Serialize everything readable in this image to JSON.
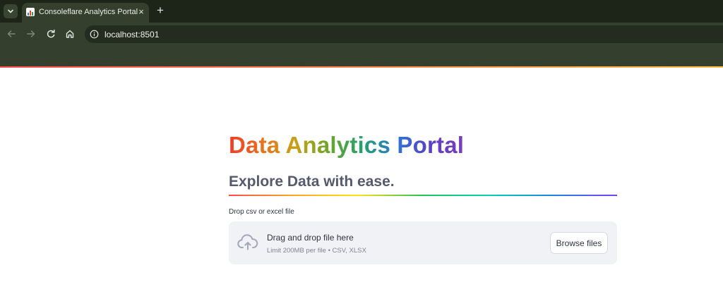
{
  "browser": {
    "tab_title": "Consoleflare Analytics Portal",
    "url": "localhost:8501",
    "new_tab_label": "+",
    "close_label": "×"
  },
  "app": {
    "title_words": [
      {
        "text": "Data",
        "color": "#e8432e"
      },
      {
        "text": "Analytics",
        "color": "#b5961c"
      },
      {
        "text": "Portal",
        "color": "#3d5bd0"
      }
    ],
    "title_gradient": [
      "#f03c28",
      "#e8721e",
      "#c9a017",
      "#6aa62c",
      "#23a06f",
      "#2b76d4",
      "#5a3fc9",
      "#7a3fb8"
    ],
    "subtitle": "Explore Data with ease.",
    "subtitle_color": "#555a6d"
  },
  "uploader": {
    "label": "Drop csv or excel file",
    "instructions": "Drag and drop file here",
    "limit": "Limit 200MB per file • CSV, XLSX",
    "button_label": "Browse files",
    "icon": "cloud-upload-icon"
  }
}
